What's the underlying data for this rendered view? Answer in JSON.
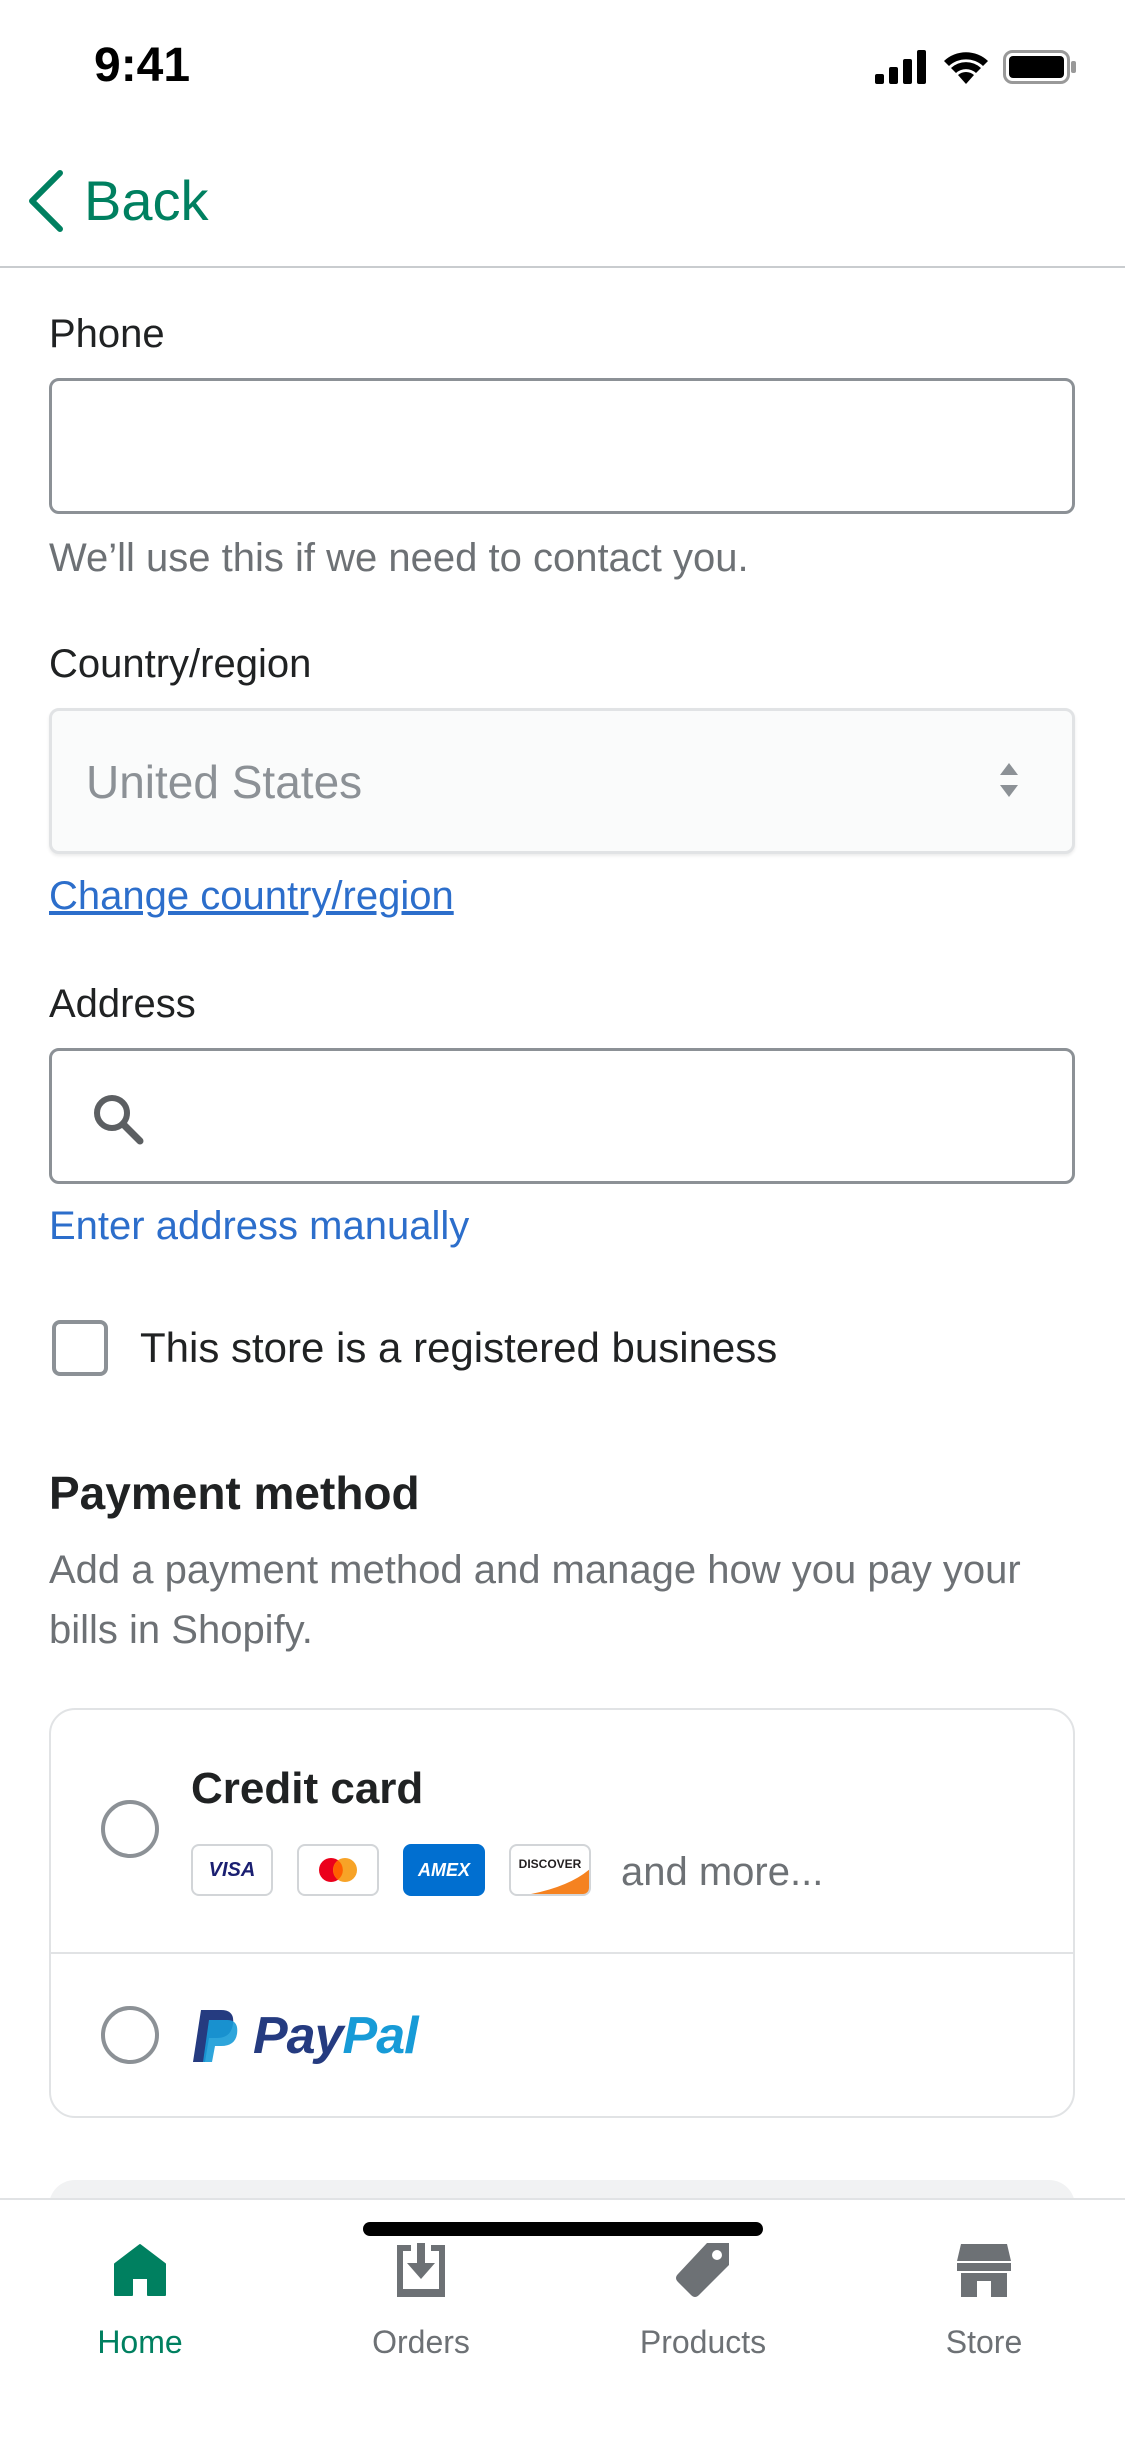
{
  "status": {
    "time": "9:41"
  },
  "nav": {
    "back_label": "Back"
  },
  "form": {
    "phone_label": "Phone",
    "phone_value": "",
    "phone_help": "We’ll use this if we need to contact you.",
    "country_label": "Country/region",
    "country_value": "United States",
    "change_country_link": "Change country/region",
    "address_label": "Address",
    "address_value": "",
    "enter_manually_link": "Enter address manually",
    "business_checkbox_label": "This store is a registered business",
    "business_checked": false
  },
  "payment": {
    "title": "Payment method",
    "description": "Add a payment method and manage how you pay your bills in Shopify.",
    "credit_card_label": "Credit card",
    "card_brands": [
      "VISA",
      "MASTERCARD",
      "AMEX",
      "DISCOVER"
    ],
    "and_more": "and more...",
    "paypal_label_1": "Pay",
    "paypal_label_2": "Pal",
    "selected": null
  },
  "tabs": [
    {
      "label": "Home",
      "icon": "home-icon",
      "active": true
    },
    {
      "label": "Orders",
      "icon": "orders-icon",
      "active": false
    },
    {
      "label": "Products",
      "icon": "tag-icon",
      "active": false
    },
    {
      "label": "Store",
      "icon": "store-icon",
      "active": false
    }
  ],
  "colors": {
    "brand_green": "#008060",
    "link_blue": "#2c6ecb",
    "paypal_dark": "#253b80",
    "paypal_light": "#179bd7"
  }
}
